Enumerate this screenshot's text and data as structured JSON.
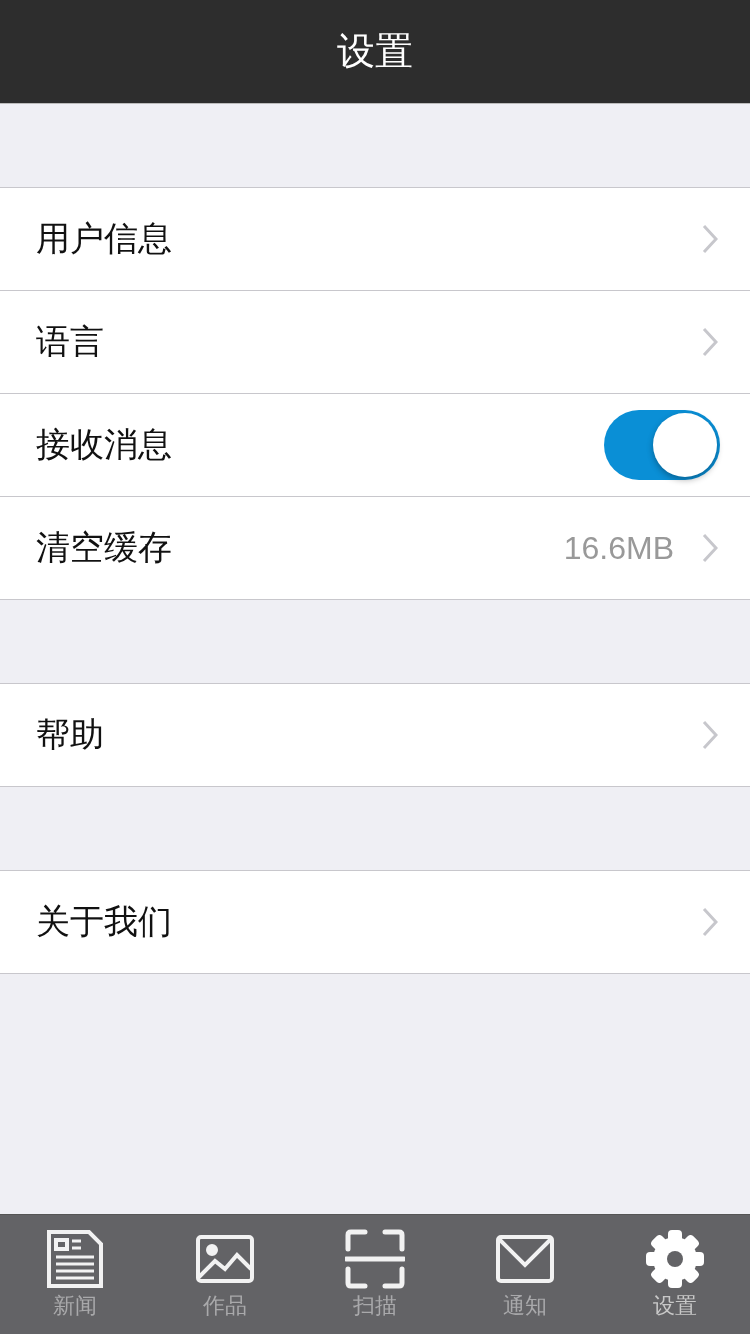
{
  "header": {
    "title": "设置"
  },
  "sections": [
    {
      "items": [
        {
          "kind": "link",
          "label": "用户信息"
        },
        {
          "kind": "link",
          "label": "语言"
        },
        {
          "kind": "toggle",
          "label": "接收消息",
          "on": true
        },
        {
          "kind": "link",
          "label": "清空缓存",
          "value": "16.6MB"
        }
      ]
    },
    {
      "items": [
        {
          "kind": "link",
          "label": "帮助"
        }
      ]
    },
    {
      "items": [
        {
          "kind": "link",
          "label": "关于我们"
        }
      ]
    }
  ],
  "tabs": [
    {
      "kind": "news",
      "label": "新闻",
      "selected": false
    },
    {
      "kind": "works",
      "label": "作品",
      "selected": false
    },
    {
      "kind": "scan",
      "label": "扫描",
      "selected": false
    },
    {
      "kind": "notice",
      "label": "通知",
      "selected": false
    },
    {
      "kind": "settings",
      "label": "设置",
      "selected": true
    }
  ]
}
